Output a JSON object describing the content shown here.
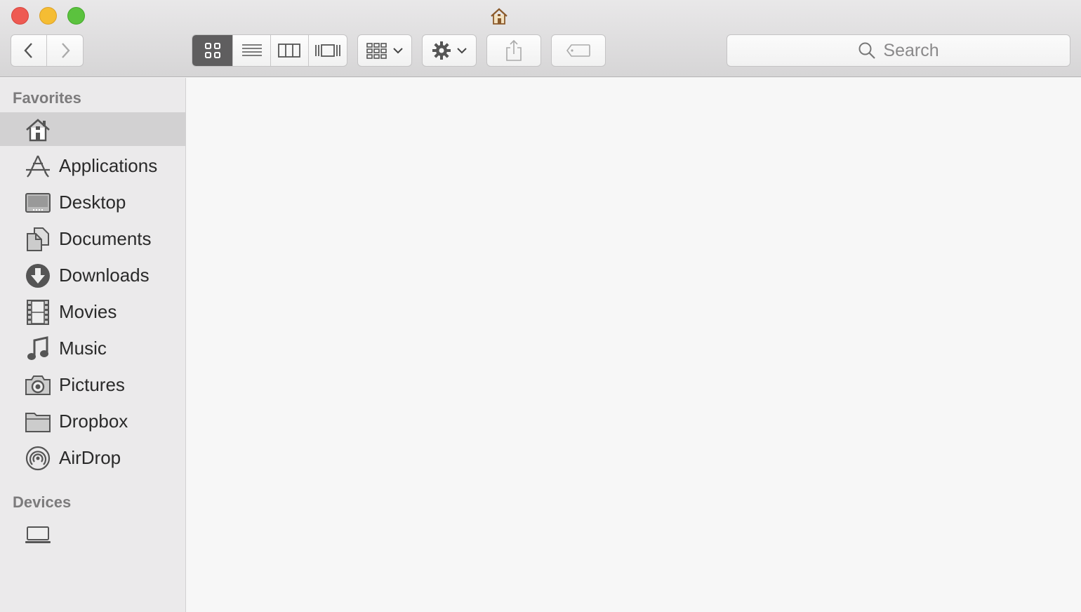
{
  "window": {
    "title_icon": "home-icon"
  },
  "toolbar": {
    "back_icon": "chevron-left-icon",
    "forward_icon": "chevron-right-icon",
    "view_modes": [
      "icon-view-icon",
      "list-view-icon",
      "column-view-icon",
      "cover-flow-icon"
    ],
    "active_view": "icon-view-icon",
    "arrange_icon": "arrange-grid-icon",
    "action_icon": "gear-icon",
    "share_icon": "share-icon",
    "tags_icon": "tag-icon",
    "search_placeholder": "Search"
  },
  "sidebar": {
    "favorites_title": "Favorites",
    "favorites": [
      {
        "label": "",
        "icon": "home-icon",
        "selected": true
      },
      {
        "label": "Applications",
        "icon": "applications-icon"
      },
      {
        "label": "Desktop",
        "icon": "desktop-icon"
      },
      {
        "label": "Documents",
        "icon": "documents-icon"
      },
      {
        "label": "Downloads",
        "icon": "downloads-icon"
      },
      {
        "label": "Movies",
        "icon": "movies-icon"
      },
      {
        "label": "Music",
        "icon": "music-icon"
      },
      {
        "label": "Pictures",
        "icon": "pictures-icon"
      },
      {
        "label": "Dropbox",
        "icon": "folder-icon"
      },
      {
        "label": "AirDrop",
        "icon": "airdrop-icon"
      }
    ],
    "devices_title": "Devices",
    "devices": [
      {
        "label": "",
        "icon": "laptop-icon"
      }
    ]
  },
  "colors": {
    "close": "#ee5a52",
    "minimize": "#f5bd33",
    "maximize": "#5bc23e",
    "sidebar_bg": "#ebeaeb",
    "selected_bg": "#d2d1d2",
    "content_bg": "#f7f7f7"
  }
}
